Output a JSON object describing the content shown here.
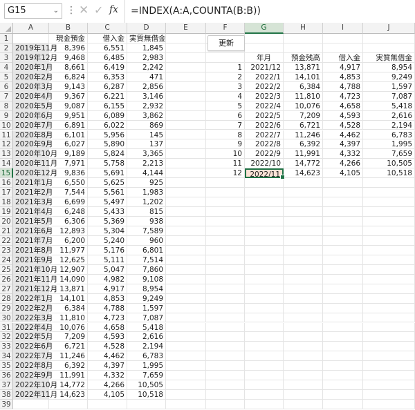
{
  "formula_bar": {
    "name_box": "G15",
    "formula": "=INDEX(A:A,COUNTA(B:B))"
  },
  "columns": [
    "A",
    "B",
    "C",
    "D",
    "E",
    "F",
    "G",
    "H",
    "I",
    "J"
  ],
  "selected_column": "G",
  "selected_row": 15,
  "row_numbers": [
    "1",
    "2",
    "3",
    "4",
    "5",
    "6",
    "7",
    "8",
    "9",
    "10",
    "11",
    "12",
    "13",
    "14",
    "15",
    "16",
    "17",
    "18",
    "19",
    "20",
    "21",
    "22",
    "23",
    "24",
    "25",
    "26",
    "27",
    "28",
    "29",
    "30",
    "31",
    "32",
    "33",
    "34",
    "35",
    "36",
    "37",
    "38",
    "39"
  ],
  "button": {
    "label": "更新"
  },
  "left_table": {
    "headers": [
      "",
      "現金預金",
      "借入金",
      "実質無借金"
    ],
    "rows": [
      [
        "2019年11月",
        "8,396",
        "6,551",
        "1,845"
      ],
      [
        "2019年12月",
        "9,468",
        "6,485",
        "2,983"
      ],
      [
        "2020年1月",
        "8,661",
        "6,419",
        "2,242"
      ],
      [
        "2020年2月",
        "6,824",
        "6,353",
        "471"
      ],
      [
        "2020年3月",
        "9,143",
        "6,287",
        "2,856"
      ],
      [
        "2020年4月",
        "9,367",
        "6,221",
        "3,146"
      ],
      [
        "2020年5月",
        "9,087",
        "6,155",
        "2,932"
      ],
      [
        "2020年6月",
        "9,951",
        "6,089",
        "3,862"
      ],
      [
        "2020年7月",
        "6,891",
        "6,022",
        "869"
      ],
      [
        "2020年8月",
        "6,101",
        "5,956",
        "145"
      ],
      [
        "2020年9月",
        "6,027",
        "5,890",
        "137"
      ],
      [
        "2020年10月",
        "9,189",
        "5,824",
        "3,365"
      ],
      [
        "2020年11月",
        "7,971",
        "5,758",
        "2,213"
      ],
      [
        "2020年12月",
        "9,836",
        "5,691",
        "4,144"
      ],
      [
        "2021年1月",
        "6,550",
        "5,625",
        "925"
      ],
      [
        "2021年2月",
        "7,544",
        "5,561",
        "1,983"
      ],
      [
        "2021年3月",
        "6,699",
        "5,497",
        "1,202"
      ],
      [
        "2021年4月",
        "6,248",
        "5,433",
        "815"
      ],
      [
        "2021年5月",
        "6,306",
        "5,369",
        "938"
      ],
      [
        "2021年6月",
        "12,893",
        "5,304",
        "7,589"
      ],
      [
        "2021年7月",
        "6,200",
        "5,240",
        "960"
      ],
      [
        "2021年8月",
        "11,977",
        "5,176",
        "6,801"
      ],
      [
        "2021年9月",
        "12,625",
        "5,111",
        "7,514"
      ],
      [
        "2021年10月",
        "12,907",
        "5,047",
        "7,860"
      ],
      [
        "2021年11月",
        "14,090",
        "4,982",
        "9,108"
      ],
      [
        "2021年12月",
        "13,871",
        "4,917",
        "8,954"
      ],
      [
        "2022年1月",
        "14,101",
        "4,853",
        "9,249"
      ],
      [
        "2022年2月",
        "6,384",
        "4,788",
        "1,597"
      ],
      [
        "2022年3月",
        "11,810",
        "4,723",
        "7,087"
      ],
      [
        "2022年4月",
        "10,076",
        "4,658",
        "5,418"
      ],
      [
        "2022年5月",
        "7,209",
        "4,593",
        "2,616"
      ],
      [
        "2022年6月",
        "6,721",
        "4,528",
        "2,194"
      ],
      [
        "2022年7月",
        "11,246",
        "4,462",
        "6,783"
      ],
      [
        "2022年8月",
        "6,392",
        "4,397",
        "1,995"
      ],
      [
        "2022年9月",
        "11,991",
        "4,332",
        "7,659"
      ],
      [
        "2022年10月",
        "14,772",
        "4,266",
        "10,505"
      ],
      [
        "2022年11月",
        "14,623",
        "4,105",
        "10,518"
      ]
    ]
  },
  "right_table": {
    "headers": [
      "",
      "年月",
      "預金残高",
      "借入金",
      "実質無借金"
    ],
    "rows": [
      [
        "1",
        "2021/12",
        "13,871",
        "4,917",
        "8,954"
      ],
      [
        "2",
        "2022/1",
        "14,101",
        "4,853",
        "9,249"
      ],
      [
        "3",
        "2022/2",
        "6,384",
        "4,788",
        "1,597"
      ],
      [
        "4",
        "2022/3",
        "11,810",
        "4,723",
        "7,087"
      ],
      [
        "5",
        "2022/4",
        "10,076",
        "4,658",
        "5,418"
      ],
      [
        "6",
        "2022/5",
        "7,209",
        "4,593",
        "2,616"
      ],
      [
        "7",
        "2022/6",
        "6,721",
        "4,528",
        "2,194"
      ],
      [
        "8",
        "2022/7",
        "11,246",
        "4,462",
        "6,783"
      ],
      [
        "9",
        "2022/8",
        "6,392",
        "4,397",
        "1,995"
      ],
      [
        "10",
        "2022/9",
        "11,991",
        "4,332",
        "7,659"
      ],
      [
        "11",
        "2022/10",
        "14,772",
        "4,266",
        "10,505"
      ],
      [
        "12",
        "2022/11",
        "14,623",
        "4,105",
        "10,518"
      ]
    ]
  },
  "icons": {
    "cancel": "cancel-icon",
    "enter": "enter-icon",
    "function": "fx-icon",
    "dropdown": "chevron-down-icon"
  },
  "colors": {
    "selection": "#217346",
    "active_cell_fill": "#fbe2d5",
    "label_fill": "#e6e6e6"
  }
}
